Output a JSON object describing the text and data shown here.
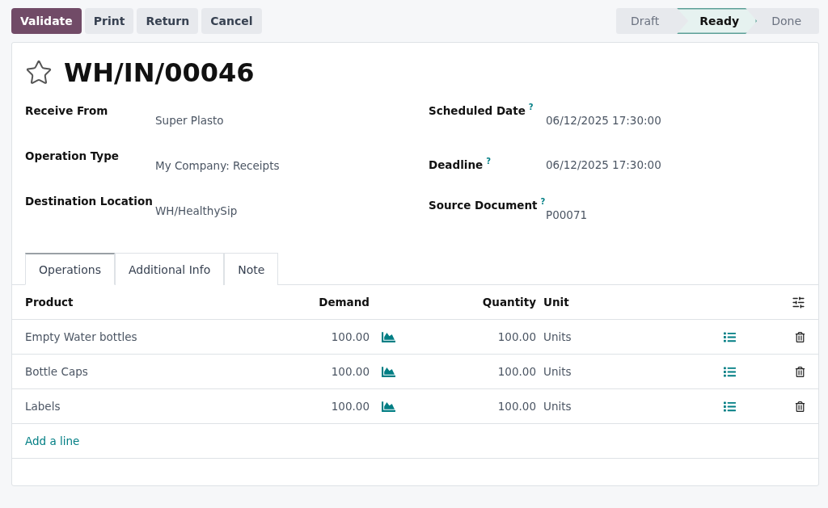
{
  "toolbar": {
    "buttons": [
      {
        "label": "Validate",
        "kind": "primary"
      },
      {
        "label": "Print",
        "kind": "secondary"
      },
      {
        "label": "Return",
        "kind": "secondary"
      },
      {
        "label": "Cancel",
        "kind": "secondary"
      }
    ]
  },
  "status_bar": [
    {
      "label": "Draft",
      "selected": false
    },
    {
      "label": "Ready",
      "selected": true
    },
    {
      "label": "Done",
      "selected": false
    }
  ],
  "record": {
    "starred": false,
    "title": "WH/IN/00046"
  },
  "fields_left": [
    {
      "label": "Receive From",
      "value": "Super Plasto"
    },
    {
      "label": "Operation Type",
      "value": "My Company: Receipts"
    },
    {
      "label": "Destination Location",
      "value": "WH/HealthySip"
    }
  ],
  "fields_right": [
    {
      "label": "Scheduled Date",
      "help": "?",
      "value": "06/12/2025 17:30:00"
    },
    {
      "label": "Deadline",
      "help": "?",
      "value": "06/12/2025 17:30:00"
    },
    {
      "label": "Source Document",
      "help": "?",
      "value": "P00071"
    }
  ],
  "tabs": [
    {
      "label": "Operations",
      "selected": true
    },
    {
      "label": "Additional Info",
      "selected": false
    },
    {
      "label": "Note",
      "selected": false
    }
  ],
  "table": {
    "columns": [
      "Product",
      "Demand",
      "Quantity",
      "Unit"
    ],
    "rows": [
      {
        "product": "Empty Water bottles",
        "demand": "100.00",
        "quantity": "100.00",
        "unit": "Units"
      },
      {
        "product": "Bottle Caps",
        "demand": "100.00",
        "quantity": "100.00",
        "unit": "Units"
      },
      {
        "product": "Labels",
        "demand": "100.00",
        "quantity": "100.00",
        "unit": "Units"
      }
    ],
    "add_line": "Add a line"
  }
}
